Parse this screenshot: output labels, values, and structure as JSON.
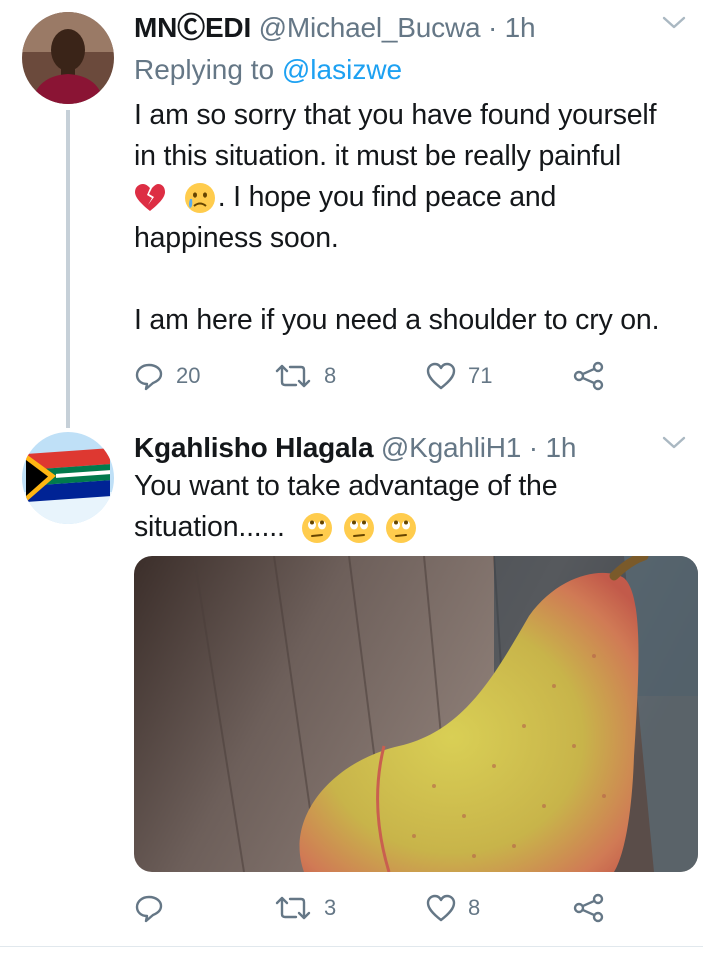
{
  "tweets": [
    {
      "display_name": "MNⒸEDI",
      "handle": "@Michael_Bucwa",
      "time": "· 1h",
      "replying_prefix": "Replying to",
      "replying_handle": "@lasizwe",
      "lines": [
        "I am so sorry that you have found yourself",
        "in this situation. it must be really painful",
        ". I hope you find peace and",
        "happiness soon.",
        "I am here if you need a shoulder to cry on."
      ],
      "emojis_line3": [
        "broken-heart",
        "crying-face"
      ],
      "replies": "20",
      "retweets": "8",
      "likes": "71"
    },
    {
      "display_name": "Kgahlisho Hlagala",
      "handle": "@KgahliH1",
      "time": "· 1h",
      "lines": [
        "You want to take advantage of the",
        "situation......"
      ],
      "emojis_line2": [
        "rolling-eyes",
        "rolling-eyes",
        "rolling-eyes"
      ],
      "replies": "",
      "retweets": "3",
      "likes": "8",
      "media": "pear-photo"
    }
  ],
  "colors": {
    "text": "#14171a",
    "secondary": "#657786",
    "link": "#1da1f2",
    "thread_line": "#c6d0d8"
  }
}
